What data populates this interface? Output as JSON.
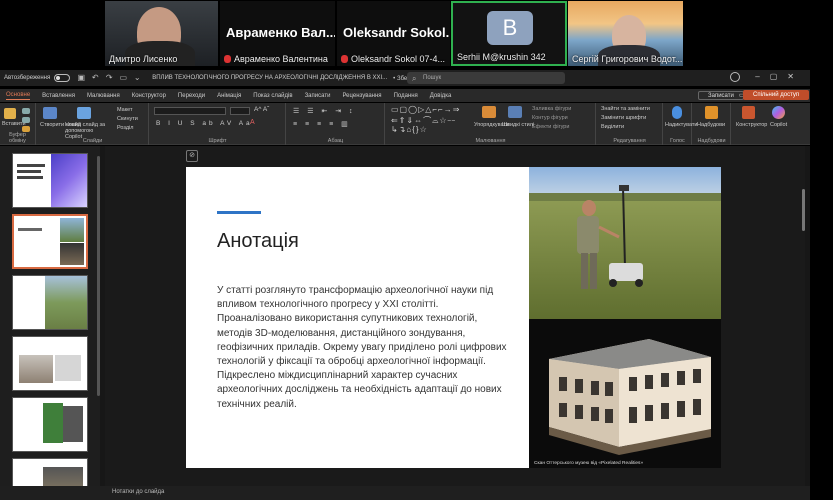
{
  "participants": [
    {
      "name": "Дмитро Лисенко",
      "muted": false
    },
    {
      "name": "Авраменко Валентина",
      "big_label": "Авраменко Вал...",
      "muted": true
    },
    {
      "name": "Oleksandr Sokol 07-4...",
      "big_label": "Oleksandr Sokol...",
      "muted": true
    },
    {
      "name": "Serhii M@krushin 342",
      "avatar_letter": "B",
      "active_speaker": true,
      "muted": false
    },
    {
      "name": "Сергій Григорович Водот...",
      "muted": false
    }
  ],
  "titlebar": {
    "autosave_label": "Автозбереження",
    "doc_title": "ВПЛИВ ТЕХНОЛОГІЧНОГО ПРОГРЕСУ НА АРХЕОЛОГІЧНІ ДОСЛІДЖЕННЯ В ХХІ...",
    "saved_status": "• Збережено у цей ПК ⌄",
    "search_placeholder": "Пошук"
  },
  "tabs": [
    "Основне",
    "Вставлення",
    "Малювання",
    "Конструктор",
    "Переходи",
    "Анімація",
    "Показ слайдів",
    "Записати",
    "Рецензування",
    "Подання",
    "Довідка"
  ],
  "tabs_right": {
    "record": "Записати",
    "share": "Спільний доступ"
  },
  "ribbon": {
    "groups": [
      "Буфер обміну",
      "Слайди",
      "Шрифт",
      "Абзац",
      "Малювання",
      "Редагування",
      "Голос",
      "Надбудови"
    ],
    "buttons": [
      "Вставити",
      "Створити слайд",
      "Новий слайд за допомогою Copilot",
      "Макет",
      "Скинути",
      "Розділ",
      "Упорядкувати",
      "Швидкі стилі",
      "Заливка фігури",
      "Контур фігури",
      "Ефекти фігури",
      "Знайти та замінити",
      "Замінити шрифти",
      "Виділити",
      "Надиктувати",
      "Надбудови",
      "Конструктор",
      "Copilot"
    ]
  },
  "thumbnails": {
    "selected_index": 1,
    "count": 6
  },
  "slide": {
    "title": "Анотація",
    "body": "У статті розглянуто трансформацію археологічної науки під впливом технологічного прогресу у ХХІ столітті. Проаналізовано використання супутникових технологій, методів 3D-моделювання, дистанційного зондування, геофізичних приладів. Окрему увагу приділено ролі цифрових технологій у фіксації та обробці археологічної інформації. Підкреслено міждисциплінарний характер сучасних археологічних досліджень та необхідність адаптації до нових технічних реалій.",
    "caption": "Скан Оттерського музею від «Pixelated Realities»"
  },
  "status": {
    "notes": "Нотатки до слайда"
  },
  "colors": {
    "accent": "#2e74c6",
    "active_tab": "#e07b57",
    "share_button": "#c04d2a",
    "active_speaker": "#2fb04f"
  }
}
